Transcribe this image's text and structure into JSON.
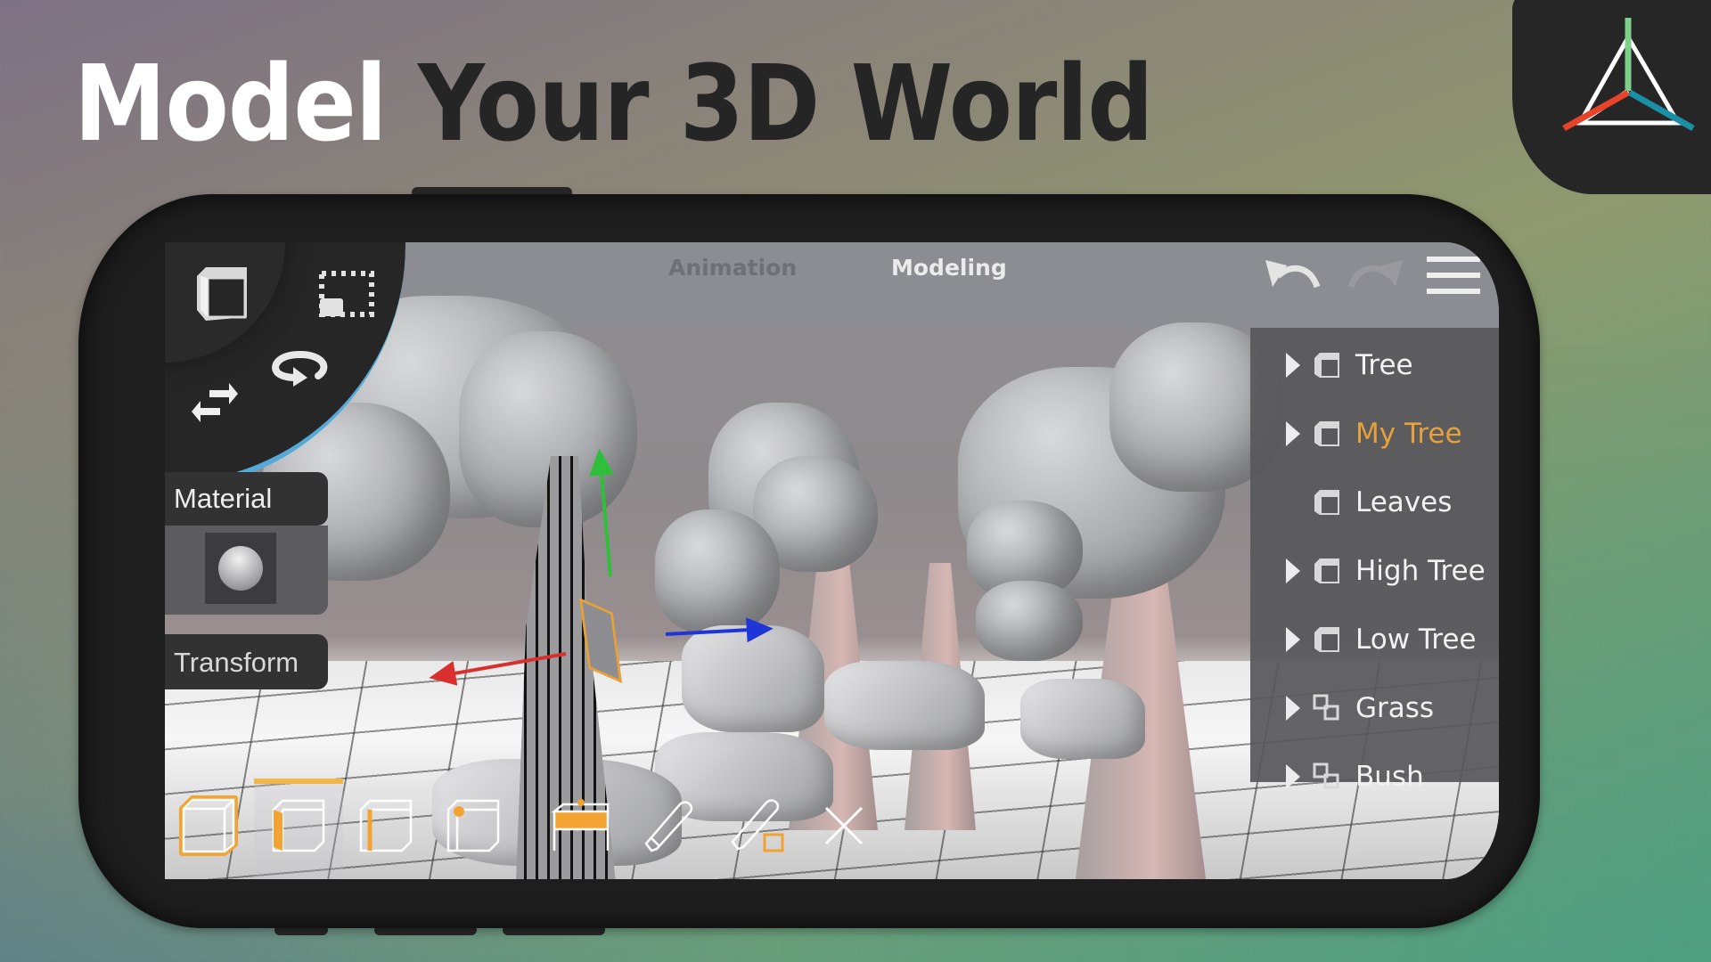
{
  "headline": {
    "word1": "Model",
    "rest": "Your 3D World"
  },
  "brand": {
    "logo_icon": "tetrahedron-axis-logo",
    "colors": {
      "x_axis": "#e8432b",
      "y_axis": "#7ecf8a",
      "z_axis": "#1a8fa5",
      "accent": "#e6a03c",
      "selection_bar": "#f1b64a"
    }
  },
  "app": {
    "tabs": [
      {
        "label": "Animation",
        "active": false
      },
      {
        "label": "Modeling",
        "active": true
      }
    ],
    "radial_tools": [
      {
        "icon": "cube-object-mode-icon",
        "label": "Object mode"
      },
      {
        "icon": "selection-rect-icon",
        "label": "Select"
      },
      {
        "icon": "rotate-icon",
        "label": "Rotate"
      },
      {
        "icon": "move-arrows-icon",
        "label": "Move"
      }
    ],
    "top_actions": [
      {
        "icon": "undo-icon",
        "enabled": true
      },
      {
        "icon": "redo-icon",
        "enabled": false
      },
      {
        "icon": "hamburger-menu-icon",
        "enabled": true
      }
    ],
    "side_panels": {
      "material": {
        "label": "Material"
      },
      "transform": {
        "label": "Transform"
      }
    },
    "outliner": [
      {
        "label": "Tree",
        "icon": "mesh-cube-icon",
        "expandable": true,
        "selected": false
      },
      {
        "label": "My Tree",
        "icon": "mesh-cube-icon",
        "expandable": true,
        "selected": true
      },
      {
        "label": "Leaves",
        "icon": "mesh-cube-icon",
        "expandable": false,
        "selected": false
      },
      {
        "label": "High Tree",
        "icon": "mesh-cube-icon",
        "expandable": true,
        "selected": false
      },
      {
        "label": "Low Tree",
        "icon": "mesh-cube-icon",
        "expandable": true,
        "selected": false
      },
      {
        "label": "Grass",
        "icon": "instance-cubes-icon",
        "expandable": true,
        "selected": false
      },
      {
        "label": "Bush",
        "icon": "instance-cubes-icon",
        "expandable": true,
        "selected": false
      }
    ],
    "bottom_toolbar": [
      {
        "icon": "object-select-icon",
        "active": false
      },
      {
        "icon": "face-select-icon",
        "active": true
      },
      {
        "icon": "edge-select-icon",
        "active": false
      },
      {
        "icon": "vertex-select-icon",
        "active": false
      },
      {
        "icon": "extrude-icon",
        "active": false
      },
      {
        "icon": "pen-draw-icon",
        "active": false
      },
      {
        "icon": "pen-loop-icon",
        "active": false
      },
      {
        "icon": "close-icon",
        "active": false
      }
    ]
  }
}
